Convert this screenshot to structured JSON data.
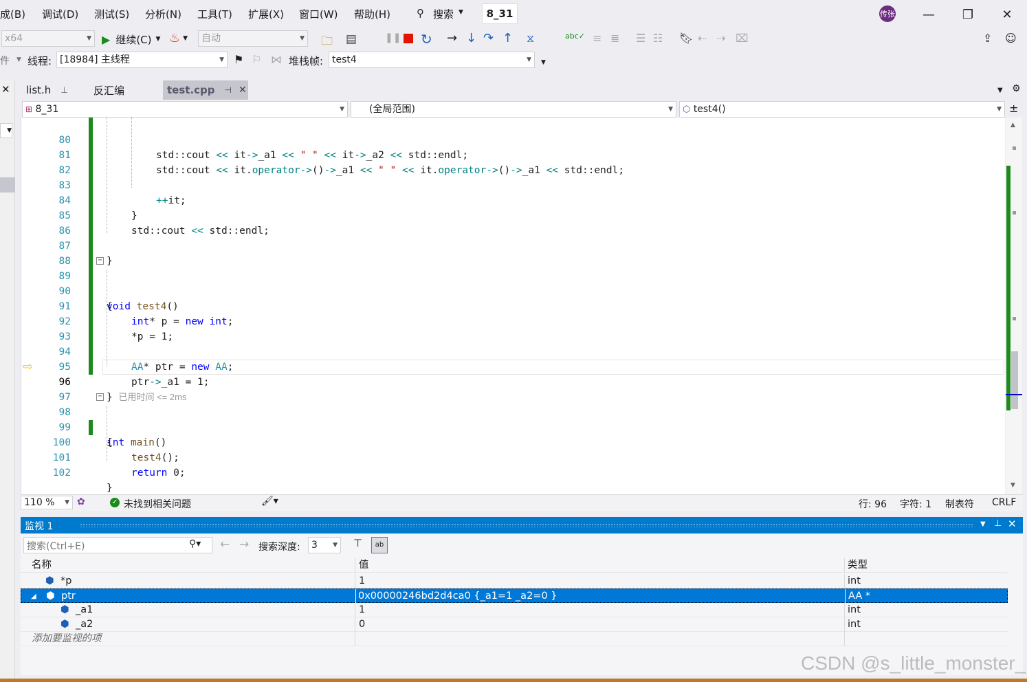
{
  "menu": {
    "items": [
      "成(B)",
      "调试(D)",
      "测试(S)",
      "分析(N)",
      "工具(T)",
      "扩展(X)",
      "窗口(W)",
      "帮助(H)"
    ],
    "search_label": "搜索",
    "solution_name": "8_31",
    "avatar_text": "传张"
  },
  "toolbar1": {
    "platform": "x64",
    "continue_label": "继续(C)",
    "auto_label": "自动"
  },
  "toolbar2": {
    "left_cut": "件",
    "thread_label": "线程:",
    "thread_value": "[18984] 主线程",
    "stack_label": "堆栈帧:",
    "stack_value": "test4"
  },
  "tabs": [
    {
      "label": "list.h",
      "active": false
    },
    {
      "label": "反汇编",
      "active": false
    },
    {
      "label": "test.cpp",
      "active": true
    }
  ],
  "navbar": {
    "project": "8_31",
    "scope": "(全局范围)",
    "function": "test4()"
  },
  "code_lines": [
    {
      "n": "80"
    },
    {
      "n": "81"
    },
    {
      "n": "82"
    },
    {
      "n": "83"
    },
    {
      "n": "84"
    },
    {
      "n": "85"
    },
    {
      "n": "86"
    },
    {
      "n": "87"
    },
    {
      "n": "88"
    },
    {
      "n": "89"
    },
    {
      "n": "90"
    },
    {
      "n": "91"
    },
    {
      "n": "92"
    },
    {
      "n": "93"
    },
    {
      "n": "94"
    },
    {
      "n": "95"
    },
    {
      "n": "96"
    },
    {
      "n": "97"
    },
    {
      "n": "98"
    },
    {
      "n": "99"
    },
    {
      "n": "100"
    },
    {
      "n": "101"
    },
    {
      "n": "102"
    }
  ],
  "elapsed_hint": "已用时间 <= 2ms",
  "editor_status": {
    "zoom": "110 %",
    "issues": "未找到相关问题",
    "line": "行: 96",
    "char": "字符: 1",
    "tabs": "制表符",
    "eol": "CRLF"
  },
  "watch": {
    "title": "监视 1",
    "search_placeholder": "搜索(Ctrl+E)",
    "depth_label": "搜索深度:",
    "depth_value": "3",
    "col_name": "名称",
    "col_value": "值",
    "col_type": "类型",
    "rows": [
      {
        "name": "*p",
        "value": "1",
        "type": "int"
      },
      {
        "name": "ptr",
        "value": "0x00000246bd2d4ca0 {_a1=1 _a2=0 }",
        "type": "AA *"
      },
      {
        "name": "_a1",
        "value": "1",
        "type": "int"
      },
      {
        "name": "_a2",
        "value": "0",
        "type": "int"
      }
    ],
    "add_item": "添加要监视的项"
  },
  "watermark": "CSDN @s_little_monster_",
  "colors": {
    "accent": "#007acc",
    "selection": "#0078d7",
    "change_bar": "#1e8a1e",
    "stop": "#e51400"
  }
}
